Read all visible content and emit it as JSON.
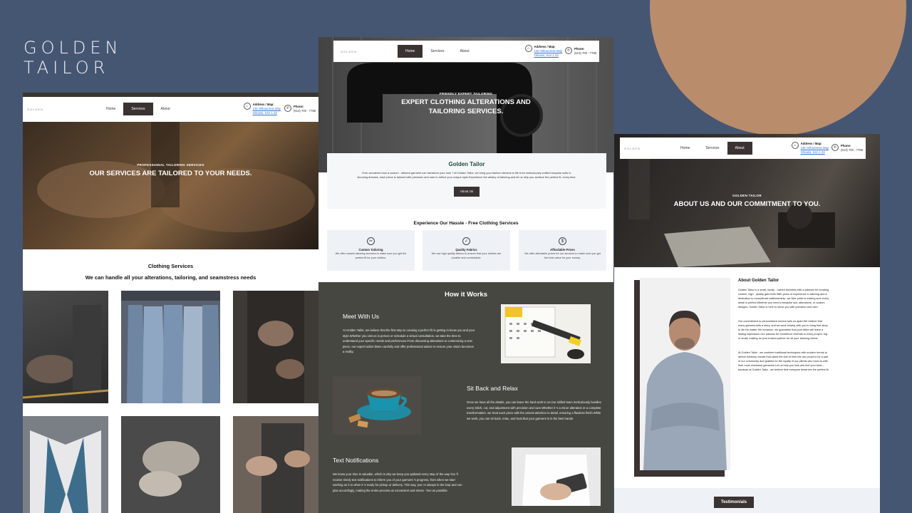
{
  "brand": {
    "line1": "GOLDEN",
    "line2": "TAILOR"
  },
  "nav": {
    "logo": "GOLDEN",
    "home": "Home",
    "services": "Services",
    "about": "About",
    "address_label": "Address / Map:",
    "address_line1": "125 Yellowcress Way",
    "address_line2": "Orleans, K4A 1 Z2",
    "phone_label": "Phone:",
    "phone_value": "(613) 700 - 7788",
    "address_icon": "location-icon",
    "phone_icon": "phone-icon"
  },
  "services_page": {
    "hero_small": "PROFESSIONAL TAILORING SERVICES",
    "hero_big": "OUR SERVICES ARE TAILORED TO YOUR NEEDS.",
    "section_title": "Clothing Services",
    "section_subtitle": "We can handle all your alterations, tailoring, and seamstress needs"
  },
  "home_page": {
    "hero_small": "FRIENDLY EXPERT TAILORING",
    "hero_big_line1": "EXPERT CLOTHING ALTERATIONS AND",
    "hero_big_line2": "TAILORING SERVICES.",
    "card_title": "Golden Tailor",
    "card_text": "Ever wondered how a custom - tailored garment can transform your look ? At Golden Tailor, we bring your fashion dreams to life from meticulously crafted bespoke suits to stunning dresses, each piece is tailored with precision and care to reflect your unique style.Experience the artistry of tailoring and let us help you achieve the perfect fit, every time.",
    "card_button": "About Us",
    "hassle_title": "Experience Our Hassle - Free Clothing Services",
    "features": [
      {
        "icon": "tailoring-icon",
        "glyph": "✂",
        "title": "Custom Tailoring",
        "text": "We offer custom tailoring services to make sure you get the perfect fit for your clothes."
      },
      {
        "icon": "check-icon",
        "glyph": "✓",
        "title": "Quality Fabrics",
        "text": "We use high quality fabrics to ensure that your clothes are durable and comfortable."
      },
      {
        "icon": "dollar-icon",
        "glyph": "$",
        "title": "Affordable Prices",
        "text": "We offer affordable prices for our services to make sure you get the best value for your money."
      }
    ],
    "how_title": "How it Works",
    "steps": [
      {
        "title": "Meet With Us",
        "text": "At Golden Tailor, we believe that the first step to creating a perfect fit is getting to know you and your style.Whether you visit us in person or schedule a virtual consultation, we take the time to understand your specific needs and preferences.From discussing alterations to customizing a new piece, our expert tailors listen carefully and offer professional advice to ensure your vision becomes a reality."
      },
      {
        "title": "Sit Back and Relax",
        "text": "Once we have all the details, you can leave the hard work to us.Our skilled team meticulously handles every stitch, cut, and adjustment with precision and care.Whether it 's a minor alteration or a complete transformation, we treat each piece with the utmost attention to detail, ensuring a flawless finish.While we work, you can sit back, relax, and trust that your garment is in the best hands."
      },
      {
        "title": "Text Notifications",
        "text": "We know your time is valuable, which is why we keep you updated every step of the way.You 'll receive timely text notifications to inform you of your garment 's progress, from when we start working on it to when it 's ready for pickup or delivery. This way, you' re always in the loop and can plan accordingly, making the entire process as convenient and stress - free as possible."
      }
    ]
  },
  "about_page": {
    "hero_small": "GOLDEN TAILOR",
    "hero_big": "ABOUT US AND OUR COMMITMENT TO YOU.",
    "about_title": "About Golden Tailor",
    "p1": "Golden Tailor is a small, family - owned business with a passion for creating custom, high - quality garments.With years of experience in tailoring and a dedication to exceptional craftsmanship, we take pride in making sure every detail is perfect.Whether you need a bespoke suit, alterations, or custom designs, Golden Tailor is here to serve you with precision and care.",
    "p2": "Our commitment to personalized service sets us apart.We believe that every garment tells a story, and we work closely with you to bring that story to life.No matter the occasion, we guarantee that your attire will leave a lasting impression.Our passion for excellence extends to every project, big or small, making us your trusted partner for all your tailoring needs.",
    "p3": "At Golden Tailor , we combine traditional techniques with modern trends to deliver timeless results that stand the test of time.We are proud to be a part of our community and grateful for the loyalty of our clients who trust us with their most cherished garments.Let us help you look and feel your best— because at Golden Tailor , we believe that everyone deserves the perfect fit.",
    "testimonials": "Testimonials"
  }
}
